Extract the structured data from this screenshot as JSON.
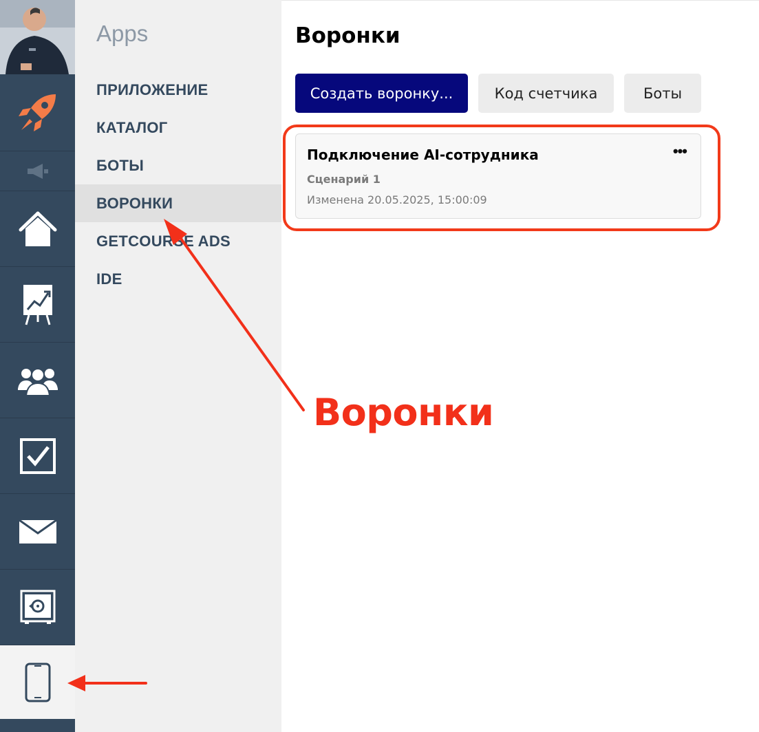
{
  "submenu": {
    "title": "Apps",
    "items": [
      {
        "label": "ПРИЛОЖЕНИЕ"
      },
      {
        "label": "КАТАЛОГ"
      },
      {
        "label": "БОТЫ"
      },
      {
        "label": "ВОРОНКИ",
        "active": true
      },
      {
        "label": "GETCOURSE ADS"
      },
      {
        "label": "IDE"
      }
    ]
  },
  "rail": {
    "icons": [
      "rocket-icon",
      "megaphone-icon",
      "home-icon",
      "chart-easel-icon",
      "users-icon",
      "checkbox-icon",
      "mail-icon",
      "safe-icon",
      "mobile-phone-icon"
    ],
    "active": "mobile-phone-icon"
  },
  "main": {
    "title": "Воронки",
    "buttons": {
      "create": "Создать воронку...",
      "counter_code": "Код счетчика",
      "bots": "Боты"
    },
    "funnels": [
      {
        "title": "Подключение AI-сотрудника",
        "more": "•••",
        "scenario": "Сценарий 1",
        "modified": "Изменена 20.05.2025, 15:00:09"
      }
    ]
  },
  "annotation": {
    "label": "Воронки",
    "color": "#f2301a"
  },
  "colors": {
    "rail": "#34495e",
    "primary_button": "#06087c",
    "annotation": "#f2301a"
  }
}
